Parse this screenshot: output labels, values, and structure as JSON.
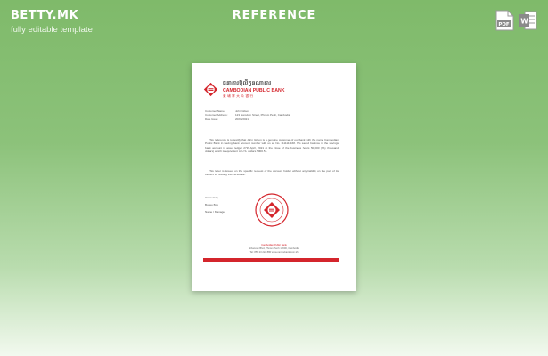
{
  "brand": {
    "logo": "BETTY.MK",
    "tagline": "fully editable template"
  },
  "title": "REFERENCE",
  "formats": [
    {
      "label": "PDF",
      "color": "#7a7a7a"
    },
    {
      "label": "W",
      "color": "#7a7a7a"
    }
  ],
  "document": {
    "bank_khmer": "ធនាគារប៊ូលីកូនណាគារ",
    "bank_en": "CAMBODIAN PUBLIC BANK",
    "bank_cn": "柬埔寨大众银行",
    "meta": [
      {
        "k": "Customer Name:",
        "v": "John Gilson"
      },
      {
        "k": "Customer Address:",
        "v": "123 Norodom Street, Phnom Penh, Cambodia"
      },
      {
        "k": "Date Issue:",
        "v": "20/04/2021"
      }
    ],
    "para1": "This reference is to testify that John Gilson is a genuine customer of our bank with the name Cambodian Public Bank in having bank account number with us as No. 1111111168. His saved balance in the savings bank account is asset ledger 27th April, 2021 at the close of the business hours 50,000 (fifty thousand dollars) which is equivalent to U.S. dollars 5000.51.",
    "para2": "This letter is issued on the specific request of the account holder without any liability on the part of its officers for issuing this certificate.",
    "sign_lines": [
      "Yours truly,",
      "Bunso Bok",
      "Name / Manager"
    ],
    "footer_lines": [
      "Cambodian Public Bank",
      "Sihanouk Blvd, Phnom Penh 12000, Cambodia",
      "Tel: 855 23 222 880  www.campubank.com.kh"
    ],
    "accent": "#d4252c"
  }
}
